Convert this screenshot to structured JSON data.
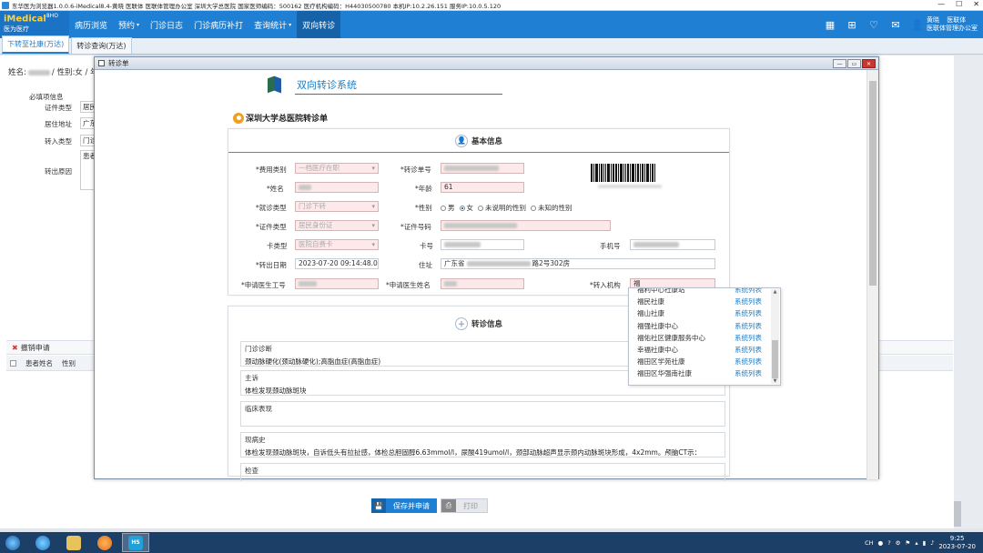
{
  "window": {
    "title": "东华医为浏览器1.0.0.6-iMedical8.4-黄晓 医联体 医联体管理办公室 深圳大学总医院 国家医师编码：500162 医疗机构编码：H44030500780 本机IP:10.2.26.151 服务IP:10.0.5.120"
  },
  "navbar": {
    "brand_main": "iMedical",
    "brand_sup": "8HO",
    "brand_sub": "医为医疗",
    "items": [
      "病历浏览",
      "预约",
      "门诊日志",
      "门诊病历补打",
      "查询统计",
      "双向转诊"
    ],
    "user_name": "黄晓",
    "user_role": "医联体",
    "user_dept": "医联体管理办公室"
  },
  "tabs": [
    "下转至社康(万达)",
    "转诊查询(万达)"
  ],
  "background": {
    "patient_line": "姓名:",
    "gender_label": "/ 性别:女 / 年",
    "required_section": "必填项信息",
    "labels": [
      "证件类型",
      "居住地址",
      "转入类型",
      "转出原因"
    ],
    "values": [
      "居民",
      "广东",
      "门诊",
      "患者"
    ],
    "toolbar_cancel": "撤销申请",
    "col_name": "患者姓名",
    "col_gender": "性别"
  },
  "actions": {
    "save": "保存并申请",
    "print": "打印"
  },
  "modal": {
    "title": "转诊单",
    "system_title": "双向转诊系统",
    "hospital_title": "深圳大学总医院转诊单",
    "section_basic": "基本信息",
    "section_referral": "转诊信息",
    "fields": {
      "fee_type": {
        "label": "*费用类别",
        "value": "一档医疗在职"
      },
      "referral_no": {
        "label": "*转诊单号"
      },
      "name": {
        "label": "*姓名"
      },
      "age": {
        "label": "*年龄",
        "value": "61"
      },
      "visit_type": {
        "label": "*就诊类型",
        "value": "门诊下转"
      },
      "gender": {
        "label": "*性别",
        "options": [
          "男",
          "女",
          "未说明的性别",
          "未知的性别"
        ],
        "selected": "女"
      },
      "id_type": {
        "label": "*证件类型",
        "value": "居民身份证"
      },
      "id_no": {
        "label": "*证件号码"
      },
      "card_type": {
        "label": "卡类型",
        "value": "医院自费卡"
      },
      "card_no": {
        "label": "卡号"
      },
      "phone": {
        "label": "手机号"
      },
      "out_date": {
        "label": "*转出日期",
        "value": "2023-07-20 09:14:48.0"
      },
      "address": {
        "label": "住址",
        "value_prefix": "广东省",
        "value_suffix": "路2号302房"
      },
      "doctor_id": {
        "label": "*申请医生工号"
      },
      "doctor_name": {
        "label": "*申请医生姓名"
      },
      "target_org": {
        "label": "*转入机构",
        "value": "福"
      }
    },
    "referral": {
      "diagnosis_label": "门诊诊断",
      "diagnosis_value": "颈动脉硬化(颈动脉硬化);高脂血症(高脂血症)",
      "complaint_label": "主诉",
      "complaint_value": "体检发现颈动脉斑块",
      "clinical_label": "临床表现",
      "history_label": "现病史",
      "history_value": "体检发现颈动脉斑块，自诉低头有拉扯感，体检总胆固醇6.63mmol/l，尿酸419umol/l，颈部动脉超声显示颈内动脉斑块形成，4x2mm。颅脑CT示：",
      "exam_label": "检查"
    }
  },
  "dropdown": {
    "link_text": "系统列表",
    "items": [
      "福利中心社康站",
      "福民社康",
      "福山社康",
      "福强社康中心",
      "福佑社区健康服务中心",
      "幸福社康中心",
      "福田区学苑社康",
      "福田区华强南社康"
    ]
  },
  "taskbar": {
    "lang": "CH",
    "time": "9:25",
    "date": "2023-07-20",
    "hs_label": "HS"
  }
}
